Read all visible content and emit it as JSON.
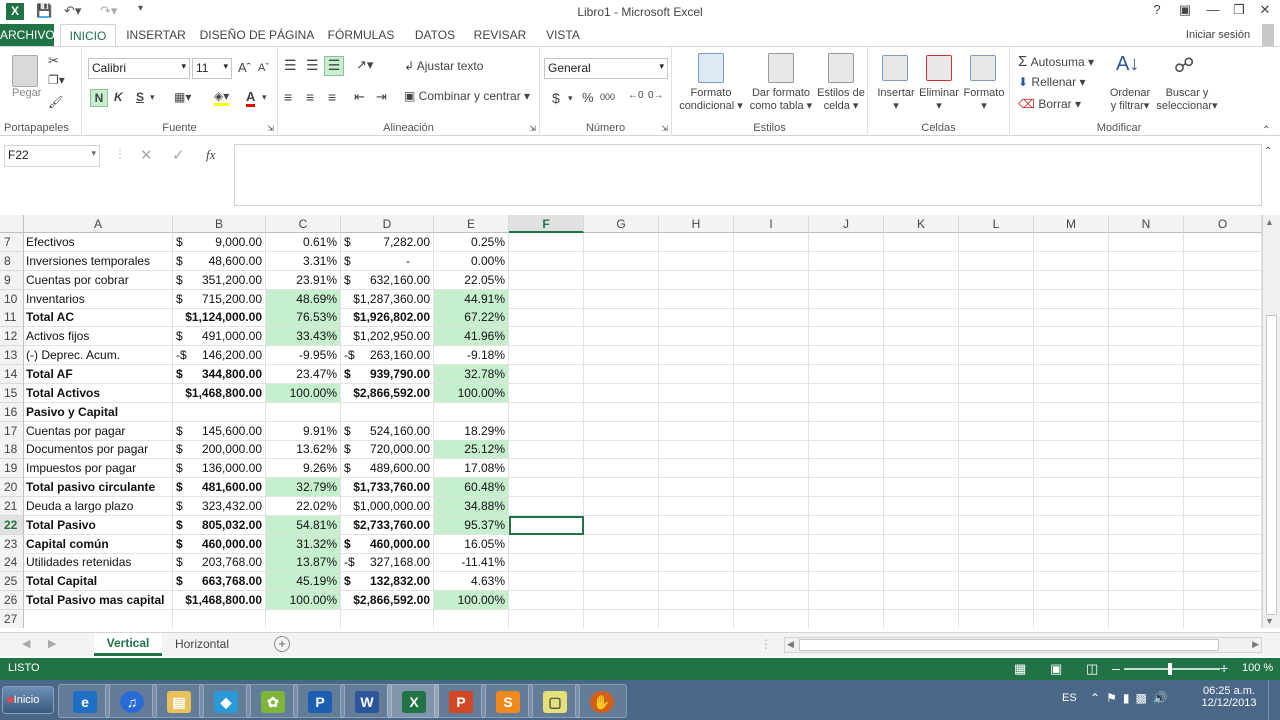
{
  "window": {
    "title": "Libro1 - Microsoft Excel",
    "help": "?"
  },
  "tabs": {
    "file": "ARCHIVO",
    "items": [
      "INICIO",
      "INSERTAR",
      "DISEÑO DE PÁGINA",
      "FÓRMULAS",
      "DATOS",
      "REVISAR",
      "VISTA"
    ],
    "signin": "Iniciar sesión"
  },
  "ribbon": {
    "clipboard": {
      "label": "Portapapeles",
      "paste": "Pegar"
    },
    "font": {
      "label": "Fuente",
      "name": "Calibri",
      "size": "11",
      "bold": "N",
      "italic": "K",
      "underline": "S"
    },
    "alignment": {
      "label": "Alineación",
      "wrap": "Ajustar texto",
      "merge": "Combinar y centrar"
    },
    "number": {
      "label": "Número",
      "format": "General",
      "currency": "$",
      "percent": "%",
      "thousands": "000"
    },
    "styles": {
      "label": "Estilos",
      "cond1": "Formato",
      "cond2": "condicional",
      "table1": "Dar formato",
      "table2": "como tabla",
      "cell1": "Estilos de",
      "cell2": "celda"
    },
    "cells": {
      "label": "Celdas",
      "insert": "Insertar",
      "delete": "Eliminar",
      "format": "Formato"
    },
    "editing": {
      "label": "Modificar",
      "autosum": "Autosuma",
      "fill": "Rellenar",
      "clear": "Borrar",
      "sort1": "Ordenar",
      "sort2": "y filtrar",
      "find1": "Buscar y",
      "find2": "seleccionar"
    }
  },
  "formula_bar": {
    "name_box": "F22",
    "fx": "fx",
    "value": ""
  },
  "columns": [
    "A",
    "B",
    "C",
    "D",
    "E",
    "F",
    "G",
    "H",
    "I",
    "J",
    "K",
    "L",
    "M",
    "N",
    "O"
  ],
  "selected_column": "F",
  "selected_row": "22",
  "rows": [
    {
      "n": "7",
      "a": "Efectivos",
      "b": "9,000.00",
      "c": "0.61%",
      "dneg": false,
      "d": "7,282.00",
      "e": "0.25%",
      "bold": false,
      "gc": false,
      "ge": false
    },
    {
      "n": "8",
      "a": "Inversiones temporales",
      "b": "48,600.00",
      "c": "3.31%",
      "d": "-",
      "e": "0.00%",
      "bold": false,
      "gc": false,
      "ge": false
    },
    {
      "n": "9",
      "a": "Cuentas por cobrar",
      "b": "351,200.00",
      "c": "23.91%",
      "d": "632,160.00",
      "e": "22.05%",
      "bold": false,
      "gc": false,
      "ge": false
    },
    {
      "n": "10",
      "a": "Inventarios",
      "b": "715,200.00",
      "c": "48.69%",
      "dplain": "$1,287,360.00",
      "e": "44.91%",
      "bold": false,
      "gc": true,
      "ge": true
    },
    {
      "n": "11",
      "a": "Total AC",
      "bplain": "$1,124,000.00",
      "c": "76.53%",
      "dplain": "$1,926,802.00",
      "e": "67.22%",
      "bold": true,
      "gc": true,
      "ge": true
    },
    {
      "n": "12",
      "a": "Activos fijos",
      "b": "491,000.00",
      "c": "33.43%",
      "dplain": "$1,202,950.00",
      "e": "41.96%",
      "bold": false,
      "gc": true,
      "ge": true
    },
    {
      "n": "13",
      "a": "(-) Deprec. Acum.",
      "bsym": "-$",
      "b": "146,200.00",
      "c": "-9.95%",
      "dsym": "-$",
      "d": "263,160.00",
      "e": "-9.18%",
      "bold": false,
      "gc": false,
      "ge": false
    },
    {
      "n": "14",
      "a": "Total AF",
      "b": "344,800.00",
      "c": "23.47%",
      "d": "939,790.00",
      "e": "32.78%",
      "bold": true,
      "gc": false,
      "ge": true
    },
    {
      "n": "15",
      "a": "Total Activos",
      "bplain": "$1,468,800.00",
      "c": "100.00%",
      "dplain": "$2,866,592.00",
      "e": "100.00%",
      "bold": true,
      "gc": true,
      "ge": true
    },
    {
      "n": "16",
      "a": "Pasivo y Capital",
      "bold": true,
      "gc": false,
      "ge": false
    },
    {
      "n": "17",
      "a": "Cuentas por pagar",
      "b": "145,600.00",
      "c": "9.91%",
      "d": "524,160.00",
      "e": "18.29%",
      "bold": false,
      "gc": false,
      "ge": false
    },
    {
      "n": "18",
      "a": "Documentos por pagar",
      "b": "200,000.00",
      "c": "13.62%",
      "d": "720,000.00",
      "e": "25.12%",
      "bold": false,
      "gc": false,
      "ge": true
    },
    {
      "n": "19",
      "a": "Impuestos por pagar",
      "b": "136,000.00",
      "c": "9.26%",
      "d": "489,600.00",
      "e": "17.08%",
      "bold": false,
      "gc": false,
      "ge": false
    },
    {
      "n": "20",
      "a": "Total pasivo circulante",
      "b": "481,600.00",
      "c": "32.79%",
      "dplain": "$1,733,760.00",
      "e": "60.48%",
      "bold": true,
      "gc": true,
      "ge": true
    },
    {
      "n": "21",
      "a": "Deuda a largo plazo",
      "b": "323,432.00",
      "c": "22.02%",
      "dplain": "$1,000,000.00",
      "e": "34.88%",
      "bold": false,
      "gc": false,
      "ge": true
    },
    {
      "n": "22",
      "a": "Total Pasivo",
      "b": "805,032.00",
      "c": "54.81%",
      "dplain": "$2,733,760.00",
      "e": "95.37%",
      "bold": true,
      "gc": true,
      "ge": true
    },
    {
      "n": "23",
      "a": "Capital común",
      "b": "460,000.00",
      "c": "31.32%",
      "d": "460,000.00",
      "e": "16.05%",
      "bold": true,
      "gc": true,
      "ge": false
    },
    {
      "n": "24",
      "a": "Utilidades retenidas",
      "b": "203,768.00",
      "c": "13.87%",
      "dsym": "-$",
      "d": "327,168.00",
      "e": "-11.41%",
      "bold": false,
      "gc": true,
      "ge": false
    },
    {
      "n": "25",
      "a": "Total Capital",
      "b": "663,768.00",
      "c": "45.19%",
      "d": "132,832.00",
      "e": "4.63%",
      "bold": true,
      "gc": true,
      "ge": false
    },
    {
      "n": "26",
      "a": "Total Pasivo mas capital",
      "bplain": "$1,468,800.00",
      "c": "100.00%",
      "dplain": "$2,866,592.00",
      "e": "100.00%",
      "bold": true,
      "gc": true,
      "ge": true
    },
    {
      "n": "27",
      "a": "",
      "bold": false,
      "gc": false,
      "ge": false
    }
  ],
  "sheets": {
    "active": "Vertical",
    "other": "Horizontal",
    "add": "+"
  },
  "status": {
    "mode": "LISTO",
    "zoom": "100 %"
  },
  "taskbar": {
    "start": "Inicio",
    "lang": "ES",
    "time": "06:25 a.m.",
    "date": "12/12/2013"
  }
}
